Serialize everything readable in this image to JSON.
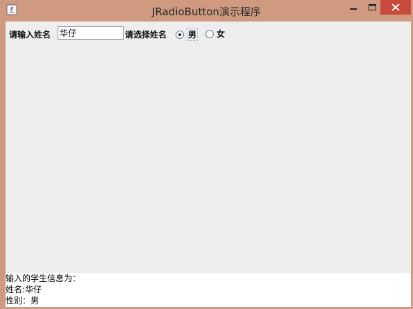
{
  "window": {
    "title": "JRadioButton演示程序",
    "icon": "java-icon",
    "colors": {
      "frame": "#cf9a80",
      "close": "#c74a3c",
      "client": "#eeeeee"
    }
  },
  "form": {
    "name_label": "请输入姓名",
    "name_value": "华仔",
    "gender_label": "请选择姓名",
    "gender_options": [
      {
        "label": "男",
        "selected": true
      },
      {
        "label": "女",
        "selected": false
      }
    ]
  },
  "output": {
    "heading": "输入的学生信息为：",
    "name_line": "姓名:华仔",
    "gender_line": "性别：男"
  }
}
